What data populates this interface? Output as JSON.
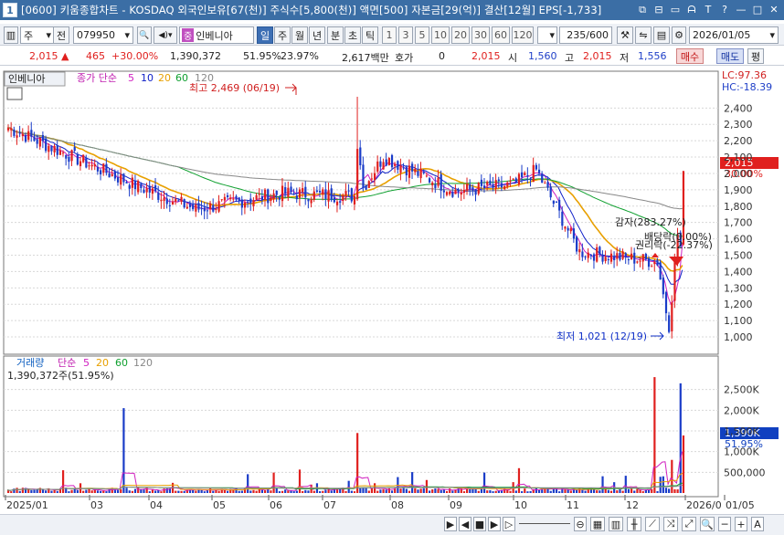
{
  "window": {
    "number": "1",
    "title": "[0600] 키움종합차트 - KOSDAQ 외국인보유[67(천)] 주식수[5,800(천)] 액면[500] 자본금[29(억)] 결산[12월] EPS[-1,733]",
    "controls": [
      "⧉",
      "⊟",
      "▭",
      "ᗩ",
      "T",
      "?",
      "—",
      "□",
      "✕"
    ]
  },
  "toolbar": {
    "market": "주",
    "market_dropdown": "▾",
    "prev_label": "전",
    "code": "079950",
    "code_dropdown": "▾",
    "search_icon": "🔍",
    "speaker_icon": "◀)",
    "speaker_dropdown": "▾",
    "stock_prefix": "중",
    "stock_name": "인베니아",
    "periods": [
      "일",
      "주",
      "월",
      "년",
      "분",
      "초",
      "틱"
    ],
    "active_period": "일",
    "intervals": [
      "1",
      "3",
      "5",
      "10",
      "20",
      "30",
      "60",
      "120"
    ],
    "interval_dropdown": "▾",
    "count": "235/600",
    "date": "2026/01/05",
    "date_dropdown": "▾"
  },
  "quote": {
    "price": "2,015",
    "arrow": "▲",
    "change": "465",
    "change_pct": "+30.00%",
    "volume": "1,390,372",
    "vol_ratio": "51.95%",
    "turnover": "23.97%",
    "amount": "2,617백만",
    "bid_label": "호가",
    "bid_value": "0",
    "bid_price": "2,015",
    "open_label": "시",
    "open_value": "1,560",
    "high_label": "고",
    "high_value": "2,015",
    "low_label": "저",
    "low_value": "1,556",
    "buy_label": "매수",
    "sell_label": "매도",
    "eval_label": "평"
  },
  "price_panel": {
    "stock_label": "인베니아",
    "ma_label": "종가 단순",
    "ma_periods": [
      "5",
      "10",
      "20",
      "60",
      "120"
    ],
    "ma_colors": [
      "#d020c0",
      "#1020c8",
      "#e8a000",
      "#10a030",
      "#888888"
    ],
    "lc": "LC:97.36",
    "hc": "HC:-18.39",
    "y_ticks": [
      "2,400",
      "2,300",
      "2,200",
      "2,100",
      "2,000",
      "1,900",
      "1,800",
      "1,700",
      "1,600",
      "1,500",
      "1,400",
      "1,300",
      "1,200",
      "1,100",
      "1,000"
    ],
    "current_tag": "2,015",
    "current_pct": "30.00%",
    "high_annot": "최고 2,469 (06/19)",
    "low_annot": "최저 1,021 (12/19)",
    "event1": "감자(283.27%)",
    "event2": "배당락(0.00%)",
    "event3": "권리락(-22.37%)"
  },
  "volume_panel": {
    "label": "거래량",
    "ma_label": "단순",
    "ma_periods": [
      "5",
      "20",
      "60",
      "120"
    ],
    "ma_colors": [
      "#d020c0",
      "#e8a000",
      "#10a030",
      "#888888"
    ],
    "value": "1,390,372주(51.95%)",
    "y_ticks": [
      "2,500K",
      "2,000K",
      "1,500K",
      "1,000K",
      "500,000"
    ],
    "current_tag": "1,390K",
    "current_pct": "51.95%"
  },
  "x_axis": [
    "2025/01",
    "03",
    "04",
    "05",
    "06",
    "07",
    "08",
    "09",
    "10",
    "11",
    "12",
    "2026/0",
    "01/05"
  ],
  "bottombar": {
    "buttons": [
      "▶",
      "◀",
      "■",
      "▶",
      "▷"
    ],
    "zoom": [
      "─",
      "+",
      "A"
    ]
  },
  "chart_data": {
    "type": "candlestick",
    "y_range": [
      950,
      2480
    ],
    "volume_range": [
      0,
      3000000
    ],
    "months": [
      "2025/01",
      "03",
      "04",
      "05",
      "06",
      "07",
      "08",
      "09",
      "10",
      "11",
      "12",
      "2026/01"
    ],
    "price_approx_path": [
      {
        "date": "2025/01",
        "close": 2280
      },
      {
        "date": "2025/02",
        "close": 2080
      },
      {
        "date": "2025/03",
        "close": 1920
      },
      {
        "date": "2025/04",
        "close": 1780
      },
      {
        "date": "2025/05",
        "close": 1880
      },
      {
        "date": "2025/06",
        "close": 1860
      },
      {
        "date": "2025/06/19",
        "close": 2100
      },
      {
        "date": "2025/07",
        "close": 1890
      },
      {
        "date": "2025/08",
        "close": 1930
      },
      {
        "date": "2025/09",
        "close": 2020
      },
      {
        "date": "2025/10",
        "close": 1520
      },
      {
        "date": "2025/11",
        "close": 1460
      },
      {
        "date": "2025/12/19",
        "close": 1060
      },
      {
        "date": "2026/01/05",
        "close": 2015
      }
    ],
    "high": 2469,
    "low": 1021,
    "last": 2015
  }
}
